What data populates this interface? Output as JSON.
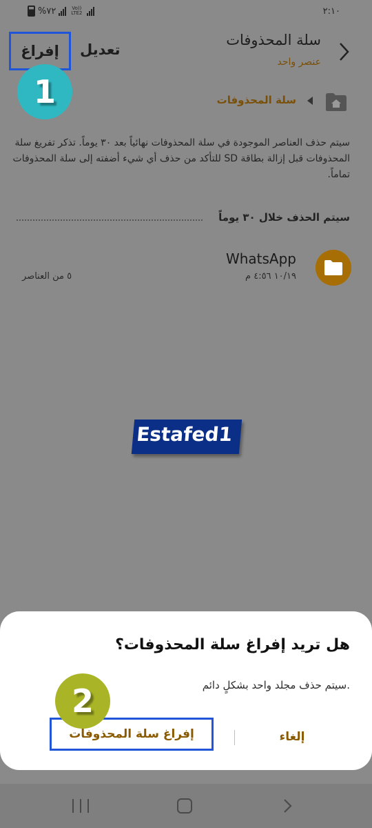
{
  "status_bar": {
    "time": "٢:١٠",
    "battery_text": "%٧٢",
    "network_label": "Vo)) LTE2"
  },
  "header": {
    "title": "سلة المحذوفات",
    "subtitle": "عنصر واحد",
    "edit_label": "تعديل",
    "empty_label": "إفراغ",
    "back_icon": "chevron-right-icon"
  },
  "annotations": {
    "step1": "1",
    "step2": "2",
    "step1_color": "#2fb8c2",
    "step2_color": "#a9b427",
    "highlight_color": "#1f55d6"
  },
  "breadcrumb": {
    "home_icon": "folder-home-icon",
    "label": "سلة المحذوفات"
  },
  "info_text": "سيتم حذف العناصر الموجودة في سلة المحذوفات نهائياً بعد ٣٠ يوماً. تذكر تفريغ سلة المحذوفات قبل إزالة بطاقة SD للتأكد من حذف أي شيء أضفته إلى سلة المحذوفات تماماً.",
  "section": {
    "label": "سيتم الحذف خلال ٣٠ يوماً"
  },
  "items": [
    {
      "name": "WhatsApp",
      "date": "١٠/١٩ ٤:٥٦ م",
      "count": "٥ من العناصر",
      "icon": "folder-icon",
      "icon_color": "#a86e06"
    }
  ],
  "watermark": {
    "text": "Estafed1"
  },
  "dialog": {
    "title": "هل تريد إفراغ سلة المحذوفات؟",
    "message": "سيتم حذف مجلد واحد بشكلٍ دائم.",
    "cancel_label": "إلغاء",
    "confirm_label": "إفراغ سلة المحذوفات",
    "accent_color": "#8a5a00"
  },
  "navbar": {
    "recents_icon": "recents-icon",
    "home_icon": "home-icon",
    "back_icon": "back-icon"
  }
}
